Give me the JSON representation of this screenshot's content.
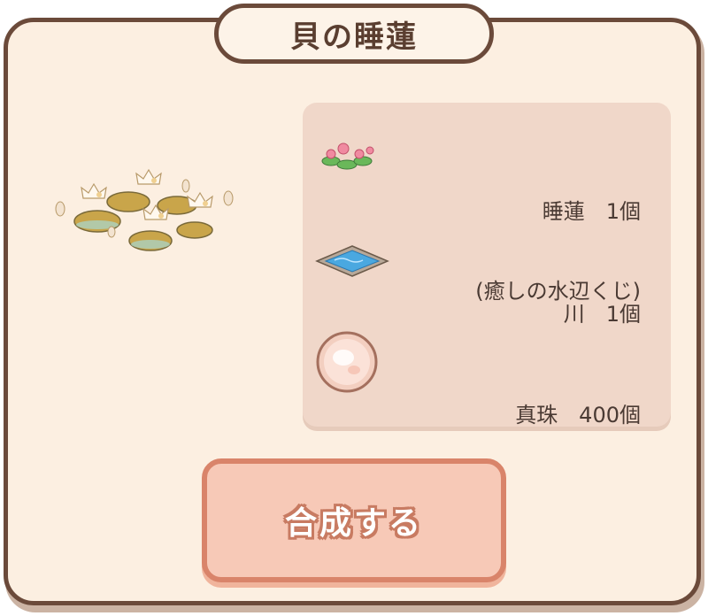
{
  "dialog": {
    "title": "貝の睡蓮"
  },
  "preview": {
    "icon": "shell-water-lily-icon"
  },
  "materials": [
    {
      "icon": "water-lily-icon",
      "line1": "睡蓮　1個",
      "line2": "(癒しの水辺くじ)"
    },
    {
      "icon": "river-icon",
      "line1": "川　1個",
      "line2": ""
    },
    {
      "icon": "pearl-icon",
      "line1": "真珠　400個",
      "line2": ""
    }
  ],
  "actions": {
    "craft_label": "合成する"
  },
  "colors": {
    "panel_bg": "#fcefe1",
    "border": "#6b4a3a",
    "materials_bg": "#f0d7c9",
    "button_bg": "#f7c9b7",
    "button_border": "#d9846a"
  }
}
